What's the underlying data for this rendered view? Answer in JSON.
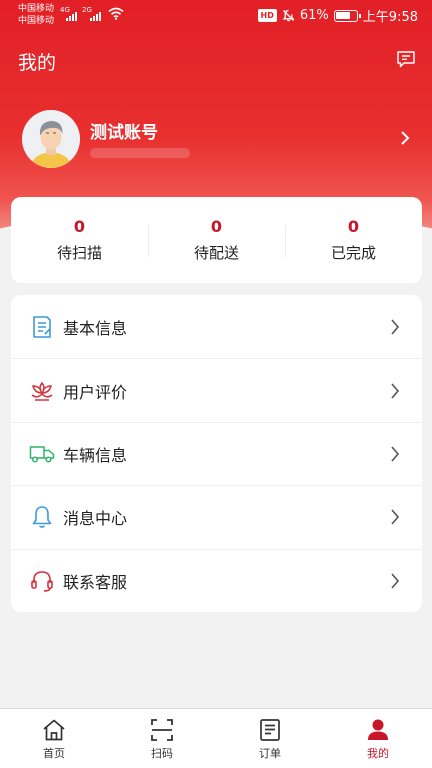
{
  "status_bar": {
    "carrier_1": "中国移动",
    "carrier_2": "中国移动",
    "net_1": "4G",
    "net_2": "2G",
    "hd": "HD",
    "battery": "61%",
    "time": "上午9:58"
  },
  "header": {
    "title": "我的"
  },
  "profile": {
    "name": "测试账号"
  },
  "stats": [
    {
      "value": "0",
      "label": "待扫描"
    },
    {
      "value": "0",
      "label": "待配送"
    },
    {
      "value": "0",
      "label": "已完成"
    }
  ],
  "menu": [
    {
      "label": "基本信息",
      "icon": "document-icon",
      "color": "#3b9ad9"
    },
    {
      "label": "用户评价",
      "icon": "lotus-icon",
      "color": "#d2323c"
    },
    {
      "label": "车辆信息",
      "icon": "truck-icon",
      "color": "#2fb56b"
    },
    {
      "label": "消息中心",
      "icon": "bell-icon",
      "color": "#3b9ad9"
    },
    {
      "label": "联系客服",
      "icon": "headset-icon",
      "color": "#d2323c"
    }
  ],
  "tabbar": [
    {
      "label": "首页",
      "icon": "home-icon",
      "active": false
    },
    {
      "label": "扫码",
      "icon": "scan-icon",
      "active": false
    },
    {
      "label": "订单",
      "icon": "order-icon",
      "active": false
    },
    {
      "label": "我的",
      "icon": "user-icon",
      "active": true
    }
  ],
  "colors": {
    "brand": "#e21f26",
    "accent": "#c8152a",
    "background": "#f2f2f2"
  }
}
